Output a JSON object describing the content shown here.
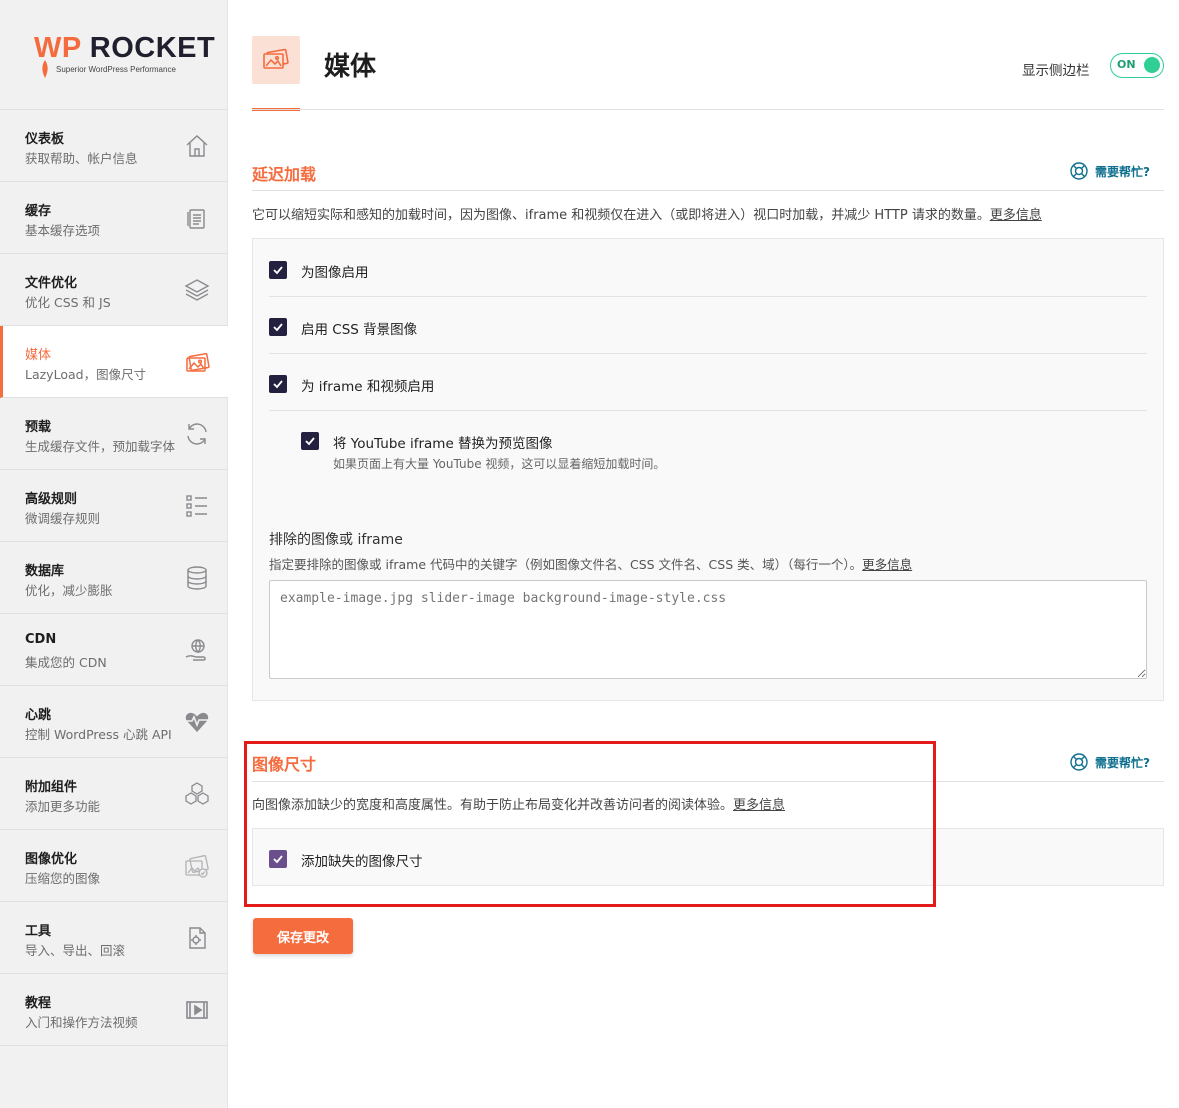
{
  "colors": {
    "accent": "#f56c3f",
    "checkbox": "#23213f",
    "toggle_on": "#2fcf95",
    "help": "#0f6f8f",
    "highlight": "#e21a1a"
  },
  "logo": {
    "brand_wp": "WP",
    "brand_name": "ROCKET",
    "tagline": "Superior WordPress Performance"
  },
  "sidebar": {
    "items": [
      {
        "title": "仪表板",
        "sub": "获取帮助、帐户信息",
        "icon": "home-icon"
      },
      {
        "title": "缓存",
        "sub": "基本缓存选项",
        "icon": "document-icon"
      },
      {
        "title": "文件优化",
        "sub": "优化 CSS 和 JS",
        "icon": "layers-icon"
      },
      {
        "title": "媒体",
        "sub": "LazyLoad，图像尺寸",
        "icon": "images-icon",
        "active": true
      },
      {
        "title": "预载",
        "sub": "生成缓存文件，预加载字体",
        "icon": "refresh-icon"
      },
      {
        "title": "高级规则",
        "sub": "微调缓存规则",
        "icon": "list-icon"
      },
      {
        "title": "数据库",
        "sub": "优化，减少膨胀",
        "icon": "database-icon"
      },
      {
        "title": "CDN",
        "sub": "集成您的 CDN",
        "icon": "globe-hand-icon"
      },
      {
        "title": "心跳",
        "sub": "控制 WordPress 心跳 API",
        "icon": "heartbeat-icon"
      },
      {
        "title": "附加组件",
        "sub": "添加更多功能",
        "icon": "cubes-icon"
      },
      {
        "title": "图像优化",
        "sub": "压缩您的图像",
        "icon": "image-optimize-icon"
      },
      {
        "title": "工具",
        "sub": "导入、导出、回滚",
        "icon": "tools-icon"
      },
      {
        "title": "教程",
        "sub": "入门和操作方法视频",
        "icon": "video-icon"
      }
    ]
  },
  "header": {
    "title": "媒体",
    "sidebar_toggle_label": "显示侧边栏",
    "toggle_state": "ON"
  },
  "lazyload": {
    "title": "延迟加载",
    "help": "需要帮忙?",
    "desc": "它可以缩短实际和感知的加载时间，因为图像、iframe 和视频仅在进入（或即将进入）视口时加载，并减少 HTTP 请求的数量。",
    "more": "更多信息",
    "options": [
      {
        "label": "为图像启用",
        "checked": true
      },
      {
        "label": "启用 CSS 背景图像",
        "checked": true
      },
      {
        "label": "为 iframe 和视频启用",
        "checked": true
      }
    ],
    "youtube": {
      "label": "将 YouTube iframe 替换为预览图像",
      "desc": "如果页面上有大量 YouTube 视频，这可以显着缩短加载时间。",
      "checked": true
    },
    "exclude": {
      "label": "排除的图像或 iframe",
      "desc": "指定要排除的图像或 iframe 代码中的关键字（例如图像文件名、CSS 文件名、CSS 类、域）（每行一个）。",
      "more": "更多信息",
      "placeholder": "example-image.jpg slider-image background-image-style.css"
    }
  },
  "image_dimensions": {
    "title": "图像尺寸",
    "help": "需要帮忙?",
    "desc": "向图像添加缺少的宽度和高度属性。有助于防止布局变化并改善访问者的阅读体验。",
    "more": "更多信息",
    "option": {
      "label": "添加缺失的图像尺寸",
      "checked": true
    }
  },
  "save_label": "保存更改"
}
